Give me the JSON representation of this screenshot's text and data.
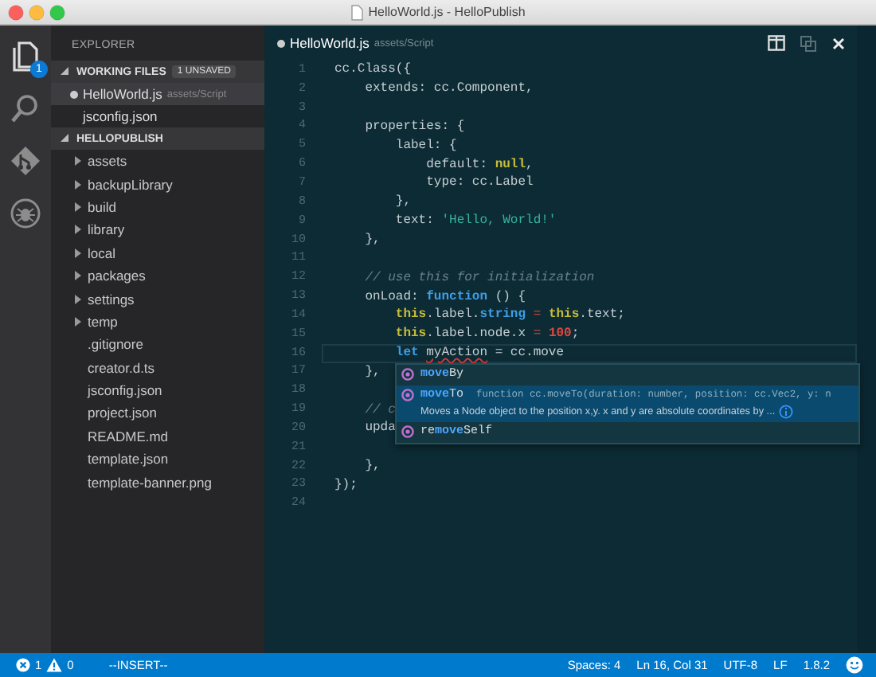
{
  "window": {
    "title": "HelloWorld.js - HelloPublish"
  },
  "activity_bar": [
    {
      "kind": "files",
      "selected": true,
      "badge": "1"
    },
    {
      "kind": "search",
      "selected": false
    },
    {
      "kind": "git",
      "selected": false
    },
    {
      "kind": "debug",
      "selected": false
    }
  ],
  "sidebar": {
    "title": "EXPLORER",
    "working_files": {
      "title": "WORKING FILES",
      "badge": "1 UNSAVED",
      "expanded": true,
      "items": [
        {
          "name": "HelloWorld.js",
          "description": "assets/Script",
          "dirty": true,
          "selected": true
        },
        {
          "name": "jsconfig.json",
          "dirty": false,
          "selected": false
        }
      ]
    },
    "project": {
      "title": "HELLOPUBLISH",
      "expanded": true,
      "items": [
        {
          "name": "assets",
          "kind": "folder",
          "expanded": false
        },
        {
          "name": "backupLibrary",
          "kind": "folder",
          "expanded": false
        },
        {
          "name": "build",
          "kind": "folder",
          "expanded": false
        },
        {
          "name": "library",
          "kind": "folder",
          "expanded": false
        },
        {
          "name": "local",
          "kind": "folder",
          "expanded": false
        },
        {
          "name": "packages",
          "kind": "folder",
          "expanded": false
        },
        {
          "name": "settings",
          "kind": "folder",
          "expanded": false
        },
        {
          "name": "temp",
          "kind": "folder",
          "expanded": false
        },
        {
          "name": ".gitignore",
          "kind": "file"
        },
        {
          "name": "creator.d.ts",
          "kind": "file"
        },
        {
          "name": "jsconfig.json",
          "kind": "file"
        },
        {
          "name": "project.json",
          "kind": "file"
        },
        {
          "name": "README.md",
          "kind": "file"
        },
        {
          "name": "template.json",
          "kind": "file"
        },
        {
          "name": "template-banner.png",
          "kind": "file"
        }
      ]
    }
  },
  "editor": {
    "tab": {
      "name": "HelloWorld.js",
      "description": "assets/Script",
      "dirty": true
    },
    "lines": [
      {
        "number": "1",
        "tokens": [
          {
            "kind": "plain",
            "text": "cc.Class({"
          }
        ]
      },
      {
        "number": "2",
        "tokens": [
          {
            "kind": "plain",
            "text": "    extends: cc.Component,"
          }
        ]
      },
      {
        "number": "3"
      },
      {
        "number": "4",
        "tokens": [
          {
            "kind": "plain",
            "text": "    properties: {"
          }
        ]
      },
      {
        "number": "5",
        "tokens": [
          {
            "kind": "plain",
            "text": "        label: {"
          }
        ]
      },
      {
        "number": "6",
        "tokens": [
          {
            "kind": "plain",
            "text": "            default: "
          },
          {
            "kind": "literal",
            "text": "null"
          },
          {
            "kind": "plain",
            "text": ","
          }
        ]
      },
      {
        "number": "7",
        "tokens": [
          {
            "kind": "plain",
            "text": "            type: cc.Label"
          }
        ]
      },
      {
        "number": "8",
        "tokens": [
          {
            "kind": "plain",
            "text": "        },"
          }
        ]
      },
      {
        "number": "9",
        "tokens": [
          {
            "kind": "plain",
            "text": "        text: "
          },
          {
            "kind": "string",
            "text": "'Hello, World!'"
          }
        ]
      },
      {
        "number": "10",
        "tokens": [
          {
            "kind": "plain",
            "text": "    },"
          }
        ]
      },
      {
        "number": "11"
      },
      {
        "number": "12",
        "tokens": [
          {
            "kind": "comment",
            "text": "    // use this for initialization"
          }
        ]
      },
      {
        "number": "13",
        "tokens": [
          {
            "kind": "plain",
            "text": "    onLoad: "
          },
          {
            "kind": "keyword",
            "text": "function"
          },
          {
            "kind": "plain",
            "text": " () {"
          }
        ]
      },
      {
        "number": "14",
        "tokens": [
          {
            "kind": "literal",
            "text": "        this"
          },
          {
            "kind": "plain",
            "text": ".label."
          },
          {
            "kind": "keyword",
            "text": "string"
          },
          {
            "kind": "operator",
            "text": " = "
          },
          {
            "kind": "literal",
            "text": "this"
          },
          {
            "kind": "plain",
            "text": ".text;"
          }
        ]
      },
      {
        "number": "15",
        "tokens": [
          {
            "kind": "literal",
            "text": "        this"
          },
          {
            "kind": "plain",
            "text": ".label.node.x"
          },
          {
            "kind": "operator",
            "text": " = "
          },
          {
            "kind": "number",
            "text": "100"
          },
          {
            "kind": "plain",
            "text": ";"
          }
        ]
      },
      {
        "number": "16",
        "current": true,
        "tokens": [
          {
            "kind": "keyword",
            "text": "        let "
          },
          {
            "kind": "squiggle",
            "text": "myAction"
          },
          {
            "kind": "plain",
            "text": " = cc.move"
          }
        ]
      },
      {
        "number": "17",
        "tokens": [
          {
            "kind": "plain",
            "text": "    },"
          }
        ]
      },
      {
        "number": "18"
      },
      {
        "number": "19",
        "tokens": [
          {
            "kind": "comment",
            "text": "    // c"
          }
        ]
      },
      {
        "number": "20",
        "tokens": [
          {
            "kind": "plain",
            "text": "    upda"
          }
        ]
      },
      {
        "number": "21"
      },
      {
        "number": "22",
        "tokens": [
          {
            "kind": "plain",
            "text": "    },"
          }
        ]
      },
      {
        "number": "23",
        "tokens": [
          {
            "kind": "plain",
            "text": "});"
          }
        ]
      },
      {
        "number": "24"
      }
    ],
    "suggestions": [
      {
        "match": "move",
        "after": "By",
        "selected": false
      },
      {
        "match": "move",
        "after": "To",
        "selected": true,
        "detail": "function cc.moveTo(duration: number, position: cc.Vec2, y: n",
        "doc": "Moves a Node object to the position x,y. x and y are absolute coordinates by ..."
      },
      {
        "before": "re",
        "match": "move",
        "after": "Self",
        "selected": false
      }
    ]
  },
  "status_bar": {
    "errors": "1",
    "warnings": "0",
    "mode": "--INSERT--",
    "items": [
      "Spaces: 4",
      "Ln 16, Col 31",
      "UTF-8",
      "LF",
      "1.8.2"
    ]
  }
}
